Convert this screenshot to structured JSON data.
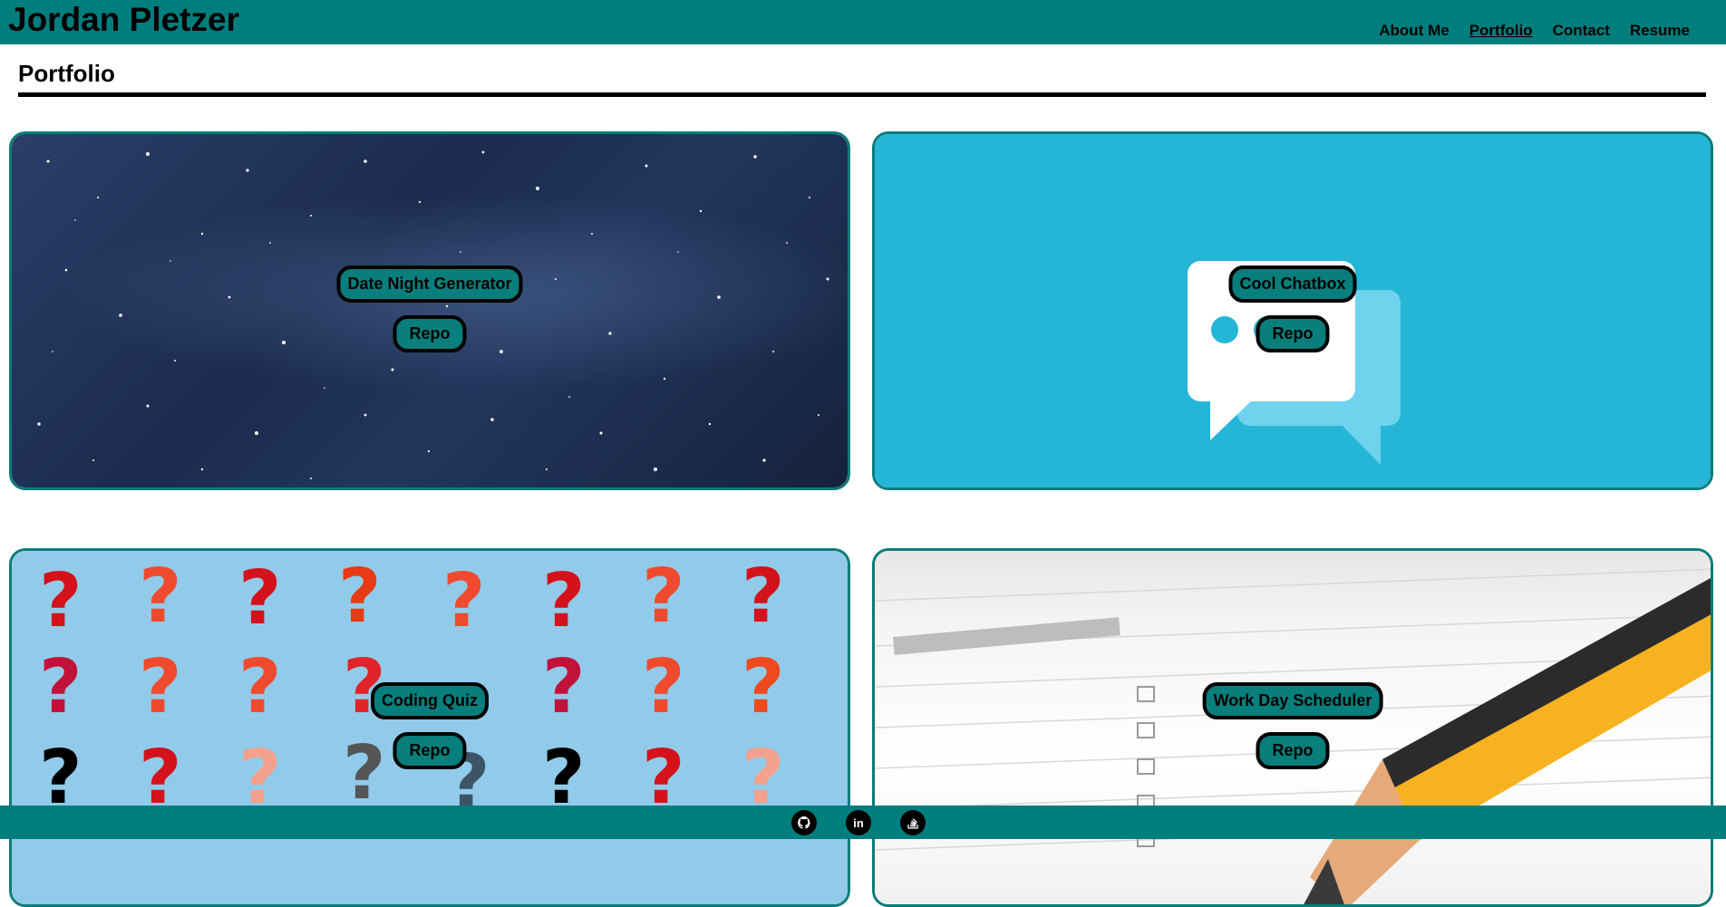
{
  "header": {
    "site_title": "Jordan Pletzer",
    "nav": [
      {
        "label": "About Me",
        "active": false
      },
      {
        "label": "Portfolio",
        "active": true
      },
      {
        "label": "Contact",
        "active": false
      },
      {
        "label": "Resume",
        "active": false
      }
    ],
    "color": "#007e7d"
  },
  "section": {
    "title": "Portfolio"
  },
  "projects": [
    {
      "name": "Date Night Generator",
      "repo_label": "Repo",
      "image": "starry-night-sky"
    },
    {
      "name": "Cool Chatbox",
      "repo_label": "Repo",
      "image": "chat-bubbles-icon"
    },
    {
      "name": "Coding Quiz",
      "repo_label": "Repo",
      "image": "question-marks"
    },
    {
      "name": "Work Day Scheduler",
      "repo_label": "Repo",
      "image": "schedule-sheet-with-pencil"
    }
  ],
  "footer": {
    "color": "#007e7d",
    "social_icons": [
      "github-icon",
      "linkedin-icon",
      "stack-overflow-icon"
    ]
  }
}
